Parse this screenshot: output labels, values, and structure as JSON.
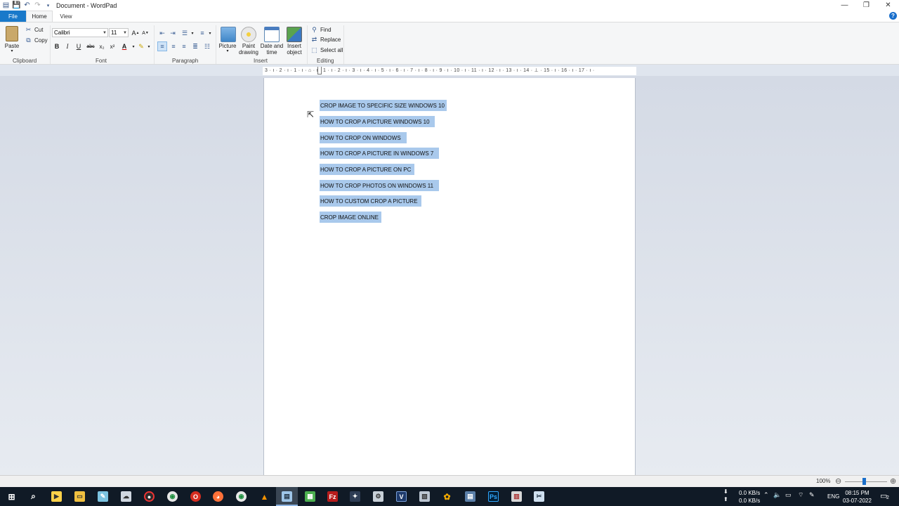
{
  "window": {
    "title": "Document - WordPad",
    "controls": {
      "minimize": "—",
      "maximize": "❐",
      "close": "✕"
    }
  },
  "tabs": [
    {
      "label": "File"
    },
    {
      "label": "Home"
    },
    {
      "label": "View"
    }
  ],
  "ribbon": {
    "clipboard": {
      "label": "Clipboard",
      "paste": "Paste",
      "cut": "Cut",
      "copy": "Copy"
    },
    "font": {
      "label": "Font",
      "family": "Calibri",
      "size": "11",
      "bold": "B",
      "italic": "I",
      "underline": "U",
      "strike": "abc",
      "subscript": "x₂",
      "superscript": "x²",
      "text_color": "A",
      "highlight": "✎"
    },
    "paragraph": {
      "label": "Paragraph"
    },
    "insert": {
      "label": "Insert",
      "picture": "Picture",
      "paint_drawing": [
        "Paint",
        "drawing"
      ],
      "date_time": [
        "Date and",
        "time"
      ],
      "insert_object": [
        "Insert",
        "object"
      ]
    },
    "editing": {
      "label": "Editing",
      "find": "Find",
      "replace": "Replace",
      "select_all": "Select all"
    }
  },
  "ruler": {
    "ticks": "3 · ı · 2 · ı · 1 · ı · ⌂ · ı · 1 · ı · 2 · ı · 3 · ı · 4 · ı · 5 · ı · 6 · ı · 7 · ı · 8 · ı · 9 · ı · 10 · ı · 11 · ı · 12 · ı · 13 · ı · 14 · ⊥ · 15 · ı · 16 · ı · 17 · ı ·"
  },
  "document": {
    "lines": [
      "CROP IMAGE TO SPECIFIC SIZE WINDOWS 10",
      "HOW TO CROP A PICTURE WINDOWS 10",
      "HOW TO CROP ON WINDOWS",
      "HOW TO CROP A PICTURE IN WINDOWS 7",
      "HOW TO CROP A PICTURE ON PC",
      "HOW TO CROP PHOTOS ON WINDOWS 11",
      "HOW TO CUSTOM CROP A PICTURE",
      "CROP IMAGE ONLINE"
    ],
    "selection_color": "#a9c9ec"
  },
  "statusbar": {
    "zoom": "100%",
    "zoom_level_percent": 100
  },
  "taskbar": {
    "net_up": "0.0 KB/s",
    "net_down": "0.0 KB/s",
    "language": "ENG",
    "time": "08:15 PM",
    "date": "03-07-2022",
    "notification_count": "2"
  }
}
